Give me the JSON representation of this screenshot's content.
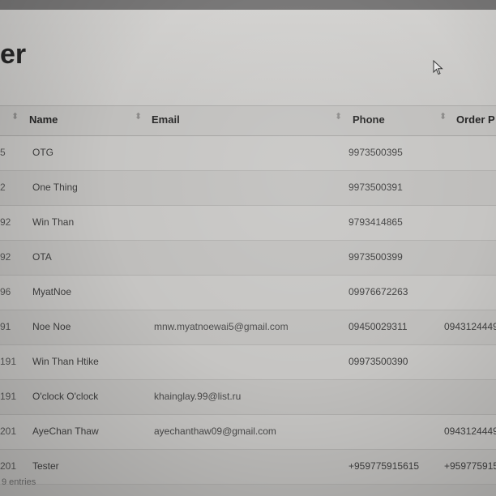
{
  "page": {
    "title": "er"
  },
  "table": {
    "columns": [
      {
        "key": "id",
        "label": ""
      },
      {
        "key": "name",
        "label": "Name"
      },
      {
        "key": "email",
        "label": "Email"
      },
      {
        "key": "phone",
        "label": "Phone"
      },
      {
        "key": "order_phone",
        "label": "Order P"
      }
    ],
    "rows": [
      {
        "id": "5",
        "name": "OTG",
        "email": "",
        "phone": "9973500395",
        "order_phone": ""
      },
      {
        "id": "2",
        "name": "One Thing",
        "email": "",
        "phone": "9973500391",
        "order_phone": ""
      },
      {
        "id": "92",
        "name": "Win Than",
        "email": "",
        "phone": "9793414865",
        "order_phone": ""
      },
      {
        "id": "92",
        "name": "OTA",
        "email": "",
        "phone": "9973500399",
        "order_phone": ""
      },
      {
        "id": "96",
        "name": "MyatNoe",
        "email": "",
        "phone": "09976672263",
        "order_phone": ""
      },
      {
        "id": "91",
        "name": "Noe Noe",
        "email": "mnw.myatnoewai5@gmail.com",
        "phone": "09450029311",
        "order_phone": "0943124449"
      },
      {
        "id": "191",
        "name": "Win Than Htike",
        "email": "",
        "phone": "09973500390",
        "order_phone": ""
      },
      {
        "id": "191",
        "name": "O'clock O'clock",
        "email": "khainglay.99@list.ru",
        "phone": "",
        "order_phone": ""
      },
      {
        "id": "201",
        "name": "AyeChan Thaw",
        "email": "ayechanthaw09@gmail.com",
        "phone": "",
        "order_phone": "0943124449"
      },
      {
        "id": "201",
        "name": "Tester",
        "email": "",
        "phone": "+959775915615",
        "order_phone": "+959775915"
      }
    ]
  },
  "footer": {
    "info": "9 entries"
  },
  "icons": {
    "sort": "sort-icon",
    "cursor": "mouse-cursor-icon"
  }
}
